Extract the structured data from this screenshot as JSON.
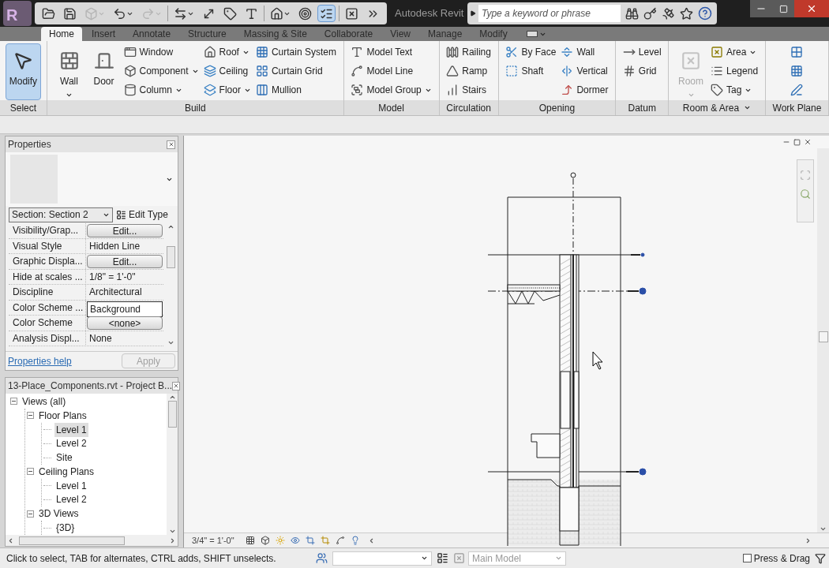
{
  "app_button": {
    "letter": "R"
  },
  "quick_access": [
    {
      "disabled": false,
      "selected": false
    },
    {
      "disabled": false,
      "selected": false
    },
    {
      "disabled": true,
      "selected": false
    },
    {
      "disabled": false,
      "selected": false
    },
    {
      "disabled": true,
      "selected": false
    },
    {
      "disabled": false,
      "selected": false
    },
    {
      "disabled": false,
      "selected": false
    },
    {
      "disabled": false,
      "selected": false
    },
    {
      "disabled": false,
      "selected": false
    },
    {
      "disabled": false,
      "selected": false
    },
    {
      "disabled": false,
      "selected": false
    },
    {
      "disabled": false,
      "selected": true
    },
    {
      "disabled": false,
      "selected": false
    },
    {
      "disabled": false,
      "selected": false
    }
  ],
  "title": "Autodesk Revit",
  "search": {
    "placeholder": "Type a keyword or phrase"
  },
  "ribbon": {
    "tabs": [
      {
        "label": "Home",
        "selected": true
      },
      {
        "label": "Insert",
        "selected": false
      },
      {
        "label": "Annotate",
        "selected": false
      },
      {
        "label": "Structure",
        "selected": false
      },
      {
        "label": "Massing & Site",
        "selected": false
      },
      {
        "label": "Collaborate",
        "selected": false
      },
      {
        "label": "View",
        "selected": false
      },
      {
        "label": "Manage",
        "selected": false
      },
      {
        "label": "Modify",
        "selected": false
      }
    ],
    "panels": [
      {
        "title": "Select",
        "menu": false,
        "columns": [
          [
            {
              "label": "Modify",
              "kind": "large",
              "dropdown": false,
              "selected": true,
              "disabled": false
            }
          ]
        ]
      },
      {
        "title": "Build",
        "menu": false,
        "columns": [
          [
            {
              "label": "Wall",
              "kind": "large",
              "dropdown": true,
              "selected": false,
              "disabled": false
            }
          ],
          [
            {
              "label": "Door",
              "kind": "large",
              "dropdown": false,
              "selected": false,
              "disabled": false
            }
          ],
          [
            {
              "label": "Window",
              "kind": "small",
              "dropdown": false,
              "selected": false,
              "disabled": false
            },
            {
              "label": "Component",
              "kind": "small",
              "dropdown": true,
              "selected": false,
              "disabled": false
            },
            {
              "label": "Column",
              "kind": "small",
              "dropdown": true,
              "selected": false,
              "disabled": false
            }
          ],
          [
            {
              "label": "Roof",
              "kind": "small",
              "dropdown": true,
              "selected": false,
              "disabled": false
            },
            {
              "label": "Ceiling",
              "kind": "small",
              "dropdown": false,
              "selected": false,
              "disabled": false
            },
            {
              "label": "Floor",
              "kind": "small",
              "dropdown": true,
              "selected": false,
              "disabled": false
            }
          ],
          [
            {
              "label": "Curtain System",
              "kind": "small",
              "dropdown": false,
              "selected": false,
              "disabled": false
            },
            {
              "label": "Curtain Grid",
              "kind": "small",
              "dropdown": false,
              "selected": false,
              "disabled": false
            },
            {
              "label": "Mullion",
              "kind": "small",
              "dropdown": false,
              "selected": false,
              "disabled": false
            }
          ]
        ]
      },
      {
        "title": "Model",
        "menu": false,
        "columns": [
          [
            {
              "label": "Model Text",
              "kind": "small",
              "dropdown": false,
              "selected": false,
              "disabled": false
            },
            {
              "label": "Model Line",
              "kind": "small",
              "dropdown": false,
              "selected": false,
              "disabled": false
            },
            {
              "label": "Model Group",
              "kind": "small",
              "dropdown": true,
              "selected": false,
              "disabled": false
            }
          ]
        ]
      },
      {
        "title": "Circulation",
        "menu": false,
        "columns": [
          [
            {
              "label": "Railing",
              "kind": "small",
              "dropdown": false,
              "selected": false,
              "disabled": false
            },
            {
              "label": "Ramp",
              "kind": "small",
              "dropdown": false,
              "selected": false,
              "disabled": false
            },
            {
              "label": "Stairs",
              "kind": "small",
              "dropdown": false,
              "selected": false,
              "disabled": false
            }
          ]
        ]
      },
      {
        "title": "Opening",
        "menu": false,
        "columns": [
          [
            {
              "label": "By Face",
              "kind": "small",
              "dropdown": false,
              "selected": false,
              "disabled": false
            },
            {
              "label": "Shaft",
              "kind": "small",
              "dropdown": false,
              "selected": false,
              "disabled": false
            }
          ],
          [
            {
              "label": "Wall",
              "kind": "small",
              "dropdown": false,
              "selected": false,
              "disabled": false
            },
            {
              "label": "Vertical",
              "kind": "small",
              "dropdown": false,
              "selected": false,
              "disabled": false
            },
            {
              "label": "Dormer",
              "kind": "small",
              "dropdown": false,
              "selected": false,
              "disabled": false
            }
          ]
        ]
      },
      {
        "title": "Datum",
        "menu": false,
        "columns": [
          [
            {
              "label": "Level",
              "kind": "small",
              "dropdown": false,
              "selected": false,
              "disabled": false
            },
            {
              "label": "Grid",
              "kind": "small",
              "dropdown": false,
              "selected": false,
              "disabled": false
            }
          ]
        ]
      },
      {
        "title": "Room & Area",
        "menu": true,
        "columns": [
          [
            {
              "label": "Room",
              "kind": "large",
              "dropdown": true,
              "selected": false,
              "disabled": true
            }
          ],
          [
            {
              "label": "Area",
              "kind": "small",
              "dropdown": true,
              "selected": false,
              "disabled": false
            },
            {
              "label": "Legend",
              "kind": "small",
              "dropdown": false,
              "selected": false,
              "disabled": false
            },
            {
              "label": "Tag",
              "kind": "small",
              "dropdown": true,
              "selected": false,
              "disabled": false
            }
          ]
        ]
      },
      {
        "title": "Work Plane",
        "menu": false,
        "columns": [
          [
            {
              "kind": "small",
              "dropdown": false,
              "selected": false,
              "disabled": false
            },
            {
              "kind": "small",
              "dropdown": false,
              "selected": false,
              "disabled": false
            },
            {
              "kind": "small",
              "dropdown": false,
              "selected": false,
              "disabled": false
            }
          ]
        ]
      }
    ]
  },
  "properties": {
    "title": "Properties",
    "type_selector": "Section: Section 2",
    "edit_type": "Edit Type",
    "rows": [
      {
        "name": "Visibility/Grap...",
        "value": "Edit...",
        "kind": "button"
      },
      {
        "name": "Visual Style",
        "value": "Hidden Line",
        "kind": "text"
      },
      {
        "name": "Graphic Displa...",
        "value": "Edit...",
        "kind": "button"
      },
      {
        "name": "Hide at scales ...",
        "value": "1/8\" = 1'-0\"",
        "kind": "text"
      },
      {
        "name": "Discipline",
        "value": "Architectural",
        "kind": "text"
      },
      {
        "name": "Color Scheme ...",
        "value": "Background",
        "kind": "field"
      },
      {
        "name": "Color Scheme",
        "value": "<none>",
        "kind": "button"
      },
      {
        "name": "Analysis Displ...",
        "value": "None",
        "kind": "text"
      }
    ],
    "help": "Properties help",
    "apply": {
      "label": "Apply",
      "disabled": true
    }
  },
  "project_browser": {
    "title": "13-Place_Components.rvt - Project B...",
    "tree": [
      {
        "label": "Views (all)",
        "expanded": true,
        "selected": false,
        "children": [
          {
            "label": "Floor Plans",
            "expanded": true,
            "selected": false,
            "children": [
              {
                "label": "Level 1",
                "selected": true
              },
              {
                "label": "Level 2",
                "selected": false
              },
              {
                "label": "Site",
                "selected": false
              }
            ]
          },
          {
            "label": "Ceiling Plans",
            "expanded": true,
            "selected": false,
            "children": [
              {
                "label": "Level 1",
                "selected": false
              },
              {
                "label": "Level 2",
                "selected": false
              }
            ]
          },
          {
            "label": "3D Views",
            "expanded": true,
            "selected": false,
            "children": [
              {
                "label": "{3D}",
                "selected": false
              }
            ]
          }
        ]
      }
    ]
  },
  "view": {
    "scale": "3/4\" = 1'-0\""
  },
  "status_bar": {
    "message": "Click to select, TAB for alternates, CTRL adds, SHIFT unselects.",
    "workset": "Main Model",
    "press_drag": {
      "label": "Press & Drag",
      "checked": false
    }
  }
}
